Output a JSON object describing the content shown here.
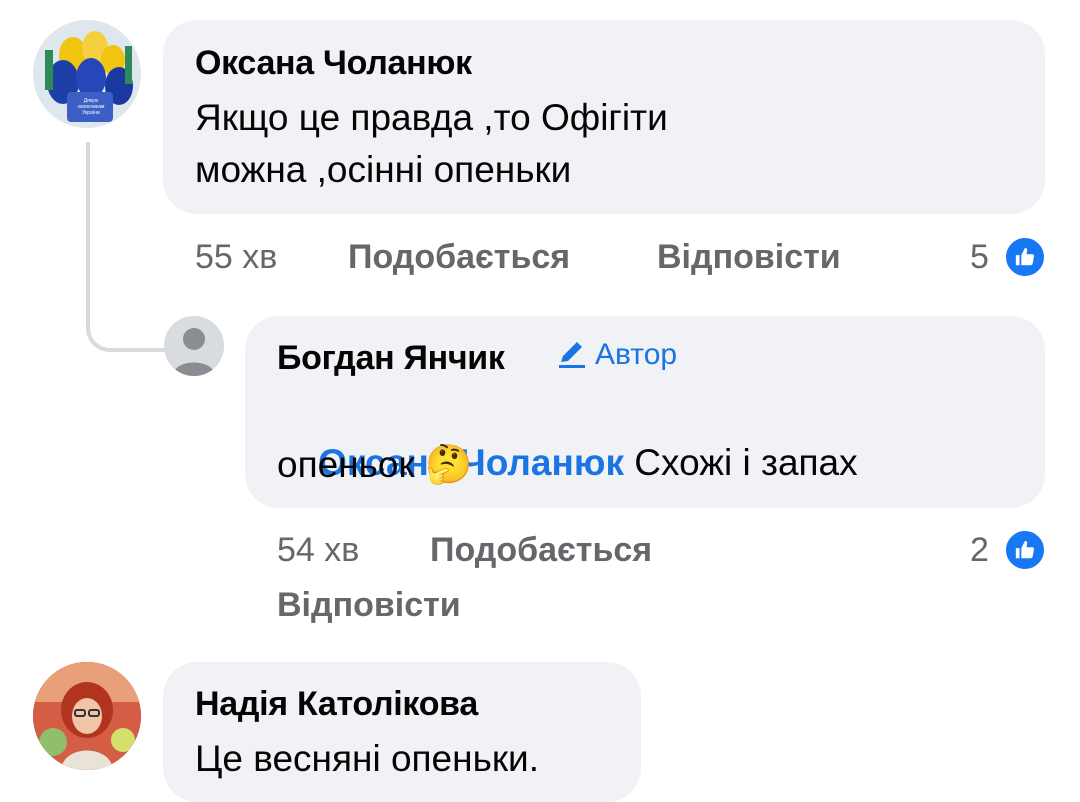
{
  "comments": [
    {
      "author": "Оксана Чоланюк",
      "text_line1": "Якщо це правда ,то Офігіти",
      "text_line2": "можна ,осінні опеньки",
      "time": "55 хв",
      "like_label": "Подобається",
      "reply_label": "Відповісти",
      "likes": "5",
      "avatar_caption": "Дякую захисникам України"
    },
    {
      "author": "Богдан Янчик",
      "badge": "Автор",
      "mention": "Оксана Чоланюк",
      "text_line1_rest": " Схожі і запах",
      "text_line2": "опеньок",
      "emoji": "🤔",
      "time": "54 хв",
      "like_label": "Подобається",
      "reply_label": "Відповісти",
      "likes": "2"
    },
    {
      "author": "Надія Католікова",
      "text_line1": "Це весняні опеньки."
    }
  ],
  "colors": {
    "bubble": "#f0f2f5",
    "link": "#1b74e4",
    "like_blue": "#1877f2",
    "meta": "#65676b"
  }
}
